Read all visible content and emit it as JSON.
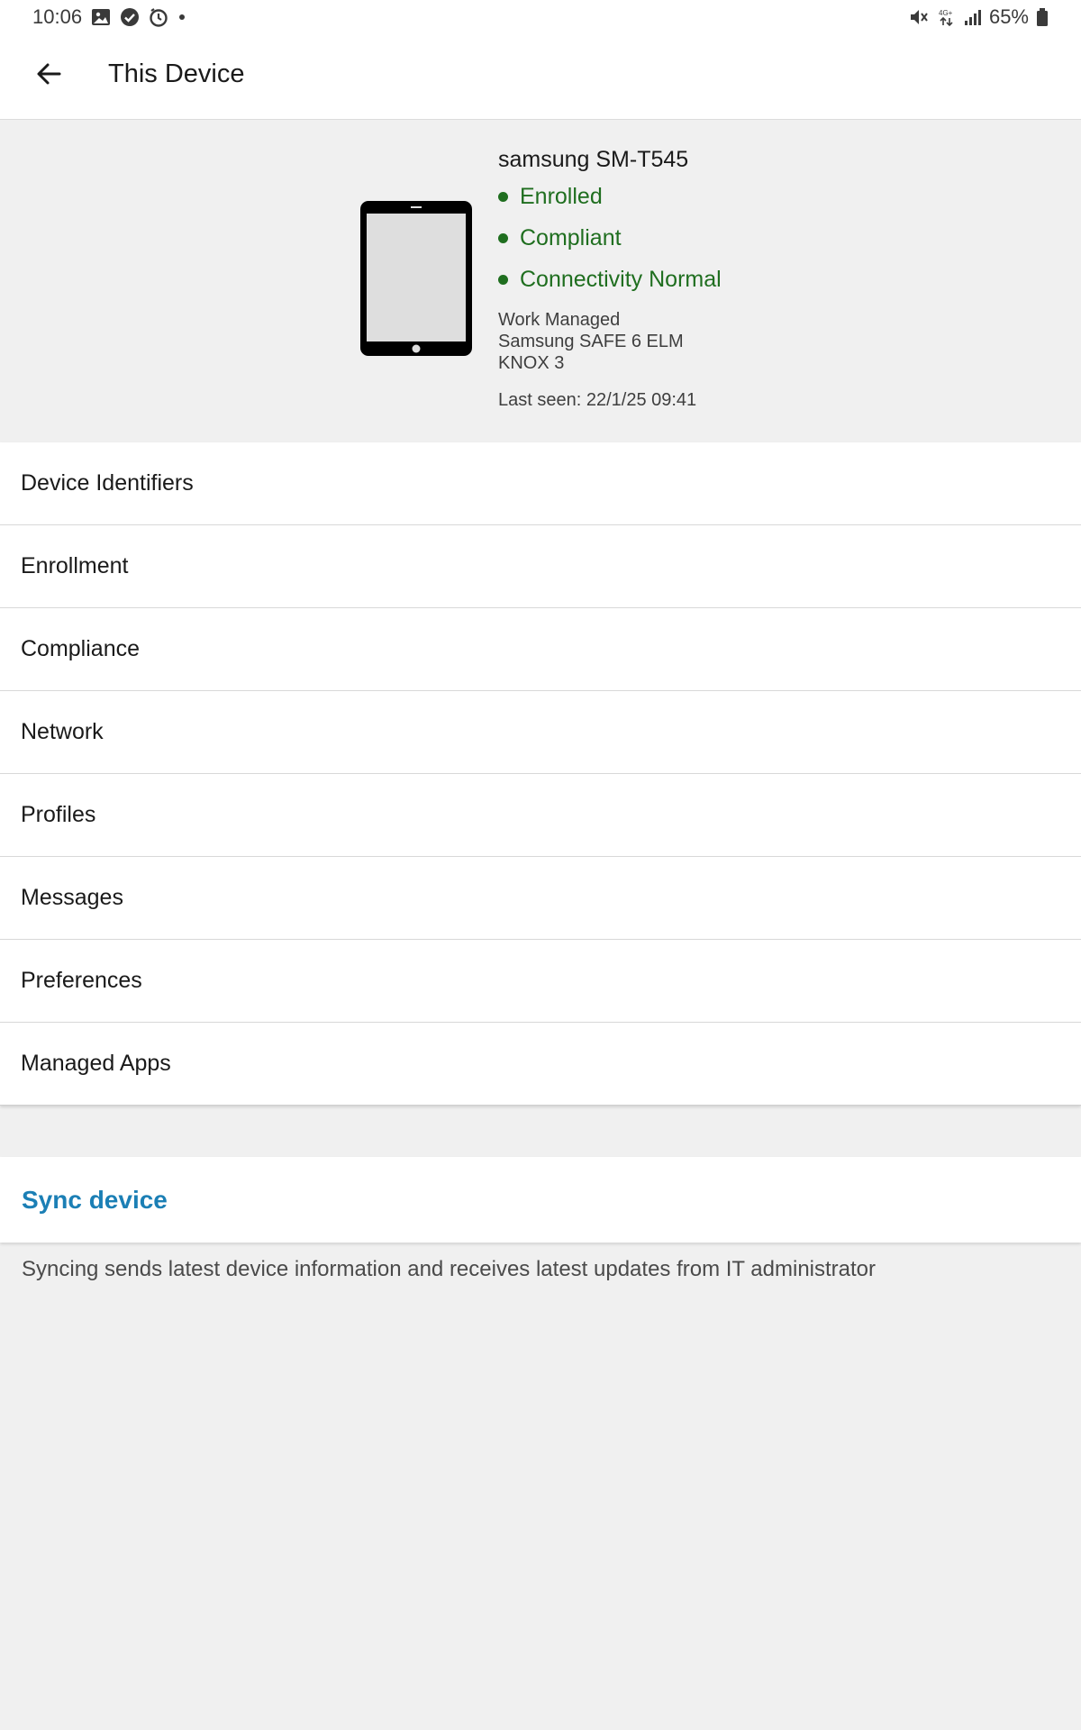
{
  "status_bar": {
    "time": "10:06",
    "left_icons": [
      "gallery-icon",
      "check-circle-icon",
      "alarm-icon",
      "dot-icon"
    ],
    "right_icons": [
      "mute-icon",
      "4g-signal-icon",
      "cell-signal-icon"
    ],
    "battery_text": "65%"
  },
  "app_bar": {
    "title": "This Device"
  },
  "device": {
    "model": "samsung SM-T545",
    "statuses": [
      {
        "label": "Enrolled"
      },
      {
        "label": "Compliant"
      },
      {
        "label": "Connectivity Normal"
      }
    ],
    "meta": [
      "Work Managed",
      "Samsung SAFE 6 ELM",
      "KNOX 3"
    ],
    "last_seen": "Last seen: 22/1/25 09:41"
  },
  "menu": {
    "items": [
      {
        "label": "Device Identifiers"
      },
      {
        "label": "Enrollment"
      },
      {
        "label": "Compliance"
      },
      {
        "label": "Network"
      },
      {
        "label": "Profiles"
      },
      {
        "label": "Messages"
      },
      {
        "label": "Preferences"
      },
      {
        "label": "Managed Apps"
      }
    ]
  },
  "sync": {
    "label": "Sync device",
    "description": "Syncing sends latest device information and receives latest updates from IT administrator"
  },
  "colors": {
    "status_green": "#1f6e1f",
    "accent_blue": "#1b7fb5",
    "background": "#f0f0f0"
  }
}
